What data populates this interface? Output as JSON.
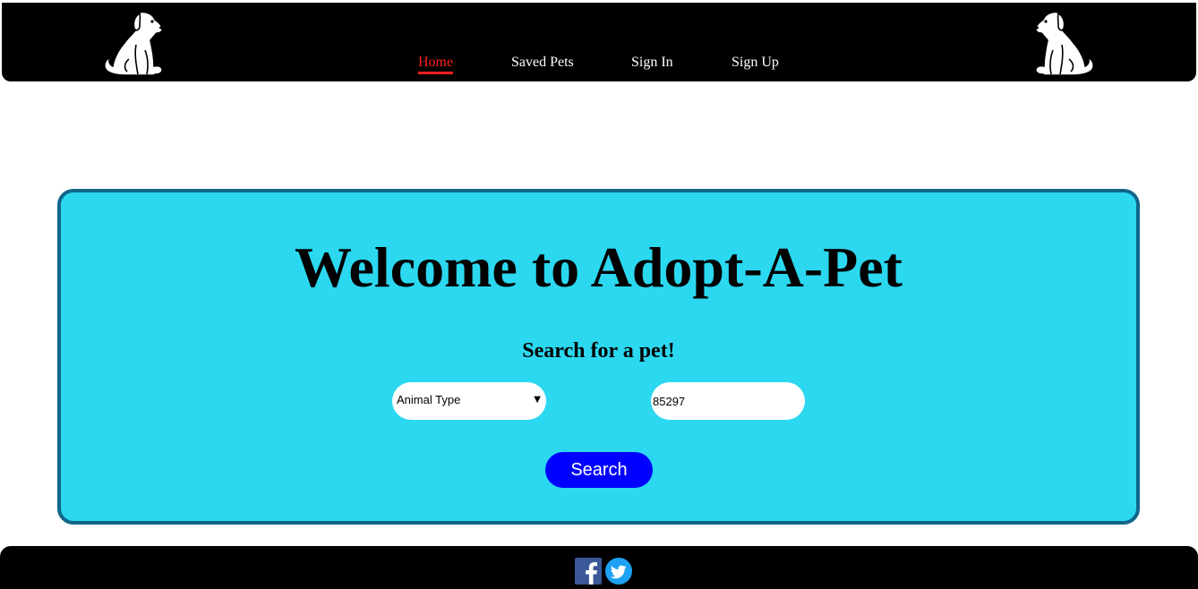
{
  "nav": {
    "items": [
      {
        "label": "Home",
        "active": true
      },
      {
        "label": "Saved Pets",
        "active": false
      },
      {
        "label": "Sign In",
        "active": false
      },
      {
        "label": "Sign Up",
        "active": false
      }
    ],
    "logo_icon": "sitting-dog-icon"
  },
  "hero": {
    "title": "Welcome to Adopt-A-Pet",
    "subtitle": "Search for a pet!",
    "animal_select": {
      "selected": "Animal Type"
    },
    "zip_input": {
      "value": "85297"
    },
    "search_label": "Search"
  },
  "footer": {
    "social_icons": [
      "facebook-icon",
      "twitter-icon"
    ]
  },
  "colors": {
    "navbar_bg": "#000000",
    "active_link": "#ff1f1f",
    "hero_bg": "#2bd8f0",
    "hero_border": "#11668a",
    "search_button": "#0000ff",
    "facebook": "#3b5998",
    "twitter": "#1da1f2"
  }
}
